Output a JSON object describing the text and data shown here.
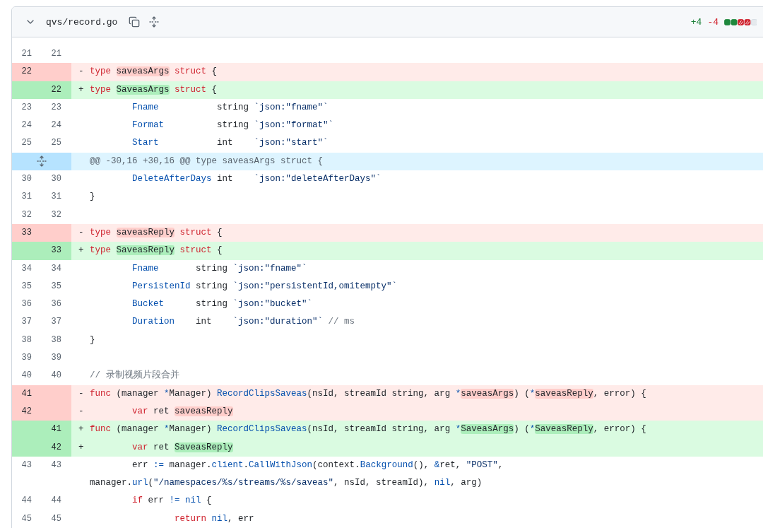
{
  "file": {
    "path": "qvs/record.go",
    "collapsed": false,
    "additions": "+4",
    "deletions": "-4"
  },
  "lines": [
    {
      "kind": "context",
      "old": "21",
      "new": "21"
    },
    {
      "kind": "deletion",
      "old": "22",
      "marker": "-",
      "tokens": [
        {
          "text": "type ",
          "kind": "keyword"
        },
        {
          "text": "saveasArgs",
          "kind": "changed"
        },
        {
          "text": " struct",
          "kind": "keyword"
        },
        {
          "text": " {",
          "kind": "plain"
        }
      ]
    },
    {
      "kind": "addition",
      "new": "22",
      "marker": "+",
      "tokens": [
        {
          "text": "type ",
          "kind": "keyword"
        },
        {
          "text": "SaveasArgs",
          "kind": "changed"
        },
        {
          "text": " struct",
          "kind": "keyword"
        },
        {
          "text": " {",
          "kind": "plain"
        }
      ]
    },
    {
      "kind": "context",
      "old": "23",
      "new": "23",
      "tokens": [
        {
          "text": "\tFname",
          "kind": "entity"
        },
        {
          "text": "           string ",
          "kind": "plain"
        },
        {
          "text": "`json:\"fname\"`",
          "kind": "string"
        }
      ]
    },
    {
      "kind": "context",
      "old": "24",
      "new": "24",
      "tokens": [
        {
          "text": "\tFormat",
          "kind": "entity"
        },
        {
          "text": "          string ",
          "kind": "plain"
        },
        {
          "text": "`json:\"format\"`",
          "kind": "string"
        }
      ]
    },
    {
      "kind": "context",
      "old": "25",
      "new": "25",
      "tokens": [
        {
          "text": "\tStart",
          "kind": "entity"
        },
        {
          "text": "           int    ",
          "kind": "plain"
        },
        {
          "text": "`json:\"start\"`",
          "kind": "string"
        }
      ]
    },
    {
      "kind": "hunk",
      "tokens": [
        {
          "text": "@@ -30,16 +30,16 @@ type saveasArgs struct {",
          "kind": "hunk"
        }
      ]
    },
    {
      "kind": "context",
      "old": "30",
      "new": "30",
      "tokens": [
        {
          "text": "\tDeleteAfterDays",
          "kind": "entity"
        },
        {
          "text": " int    ",
          "kind": "plain"
        },
        {
          "text": "`json:\"deleteAfterDays\"`",
          "kind": "string"
        }
      ]
    },
    {
      "kind": "context",
      "old": "31",
      "new": "31",
      "tokens": [
        {
          "text": "}",
          "kind": "plain"
        }
      ]
    },
    {
      "kind": "context",
      "old": "32",
      "new": "32"
    },
    {
      "kind": "deletion",
      "old": "33",
      "marker": "-",
      "tokens": [
        {
          "text": "type ",
          "kind": "keyword"
        },
        {
          "text": "saveasReply",
          "kind": "changed"
        },
        {
          "text": " struct",
          "kind": "keyword"
        },
        {
          "text": " {",
          "kind": "plain"
        }
      ]
    },
    {
      "kind": "addition",
      "new": "33",
      "marker": "+",
      "tokens": [
        {
          "text": "type ",
          "kind": "keyword"
        },
        {
          "text": "SaveasReply",
          "kind": "changed"
        },
        {
          "text": " struct",
          "kind": "keyword"
        },
        {
          "text": " {",
          "kind": "plain"
        }
      ]
    },
    {
      "kind": "context",
      "old": "34",
      "new": "34",
      "tokens": [
        {
          "text": "\tFname",
          "kind": "entity"
        },
        {
          "text": "       string ",
          "kind": "plain"
        },
        {
          "text": "`json:\"fname\"`",
          "kind": "string"
        }
      ]
    },
    {
      "kind": "context",
      "old": "35",
      "new": "35",
      "tokens": [
        {
          "text": "\tPersistenId",
          "kind": "entity"
        },
        {
          "text": " string ",
          "kind": "plain"
        },
        {
          "text": "`json:\"persistentId,omitempty\"`",
          "kind": "string"
        }
      ]
    },
    {
      "kind": "context",
      "old": "36",
      "new": "36",
      "tokens": [
        {
          "text": "\tBucket",
          "kind": "entity"
        },
        {
          "text": "      string ",
          "kind": "plain"
        },
        {
          "text": "`json:\"bucket\"`",
          "kind": "string"
        }
      ]
    },
    {
      "kind": "context",
      "old": "37",
      "new": "37",
      "tokens": [
        {
          "text": "\tDuration",
          "kind": "entity"
        },
        {
          "text": "    int    ",
          "kind": "plain"
        },
        {
          "text": "`json:\"duration\"`",
          "kind": "string"
        },
        {
          "text": " // ms",
          "kind": "comment"
        }
      ]
    },
    {
      "kind": "context",
      "old": "38",
      "new": "38",
      "tokens": [
        {
          "text": "}",
          "kind": "plain"
        }
      ]
    },
    {
      "kind": "context",
      "old": "39",
      "new": "39"
    },
    {
      "kind": "context",
      "old": "40",
      "new": "40",
      "tokens": [
        {
          "text": "// 录制视频片段合并",
          "kind": "comment"
        }
      ]
    },
    {
      "kind": "deletion",
      "old": "41",
      "marker": "-",
      "tokens": [
        {
          "text": "func",
          "kind": "keyword"
        },
        {
          "text": " (manager ",
          "kind": "plain"
        },
        {
          "text": "*",
          "kind": "entity"
        },
        {
          "text": "Manager) ",
          "kind": "plain"
        },
        {
          "text": "RecordClipsSaveas",
          "kind": "entity"
        },
        {
          "text": "(nsId, streamId string, arg ",
          "kind": "plain"
        },
        {
          "text": "*",
          "kind": "entity"
        },
        {
          "text": "saveasArgs",
          "kind": "changed"
        },
        {
          "text": ") (",
          "kind": "plain"
        },
        {
          "text": "*",
          "kind": "entity"
        },
        {
          "text": "saveasReply",
          "kind": "changed"
        },
        {
          "text": ", error) {",
          "kind": "plain"
        }
      ]
    },
    {
      "kind": "deletion",
      "old": "42",
      "marker": "-",
      "tokens": [
        {
          "text": "\tvar",
          "kind": "keyword"
        },
        {
          "text": " ret ",
          "kind": "plain"
        },
        {
          "text": "saveasReply",
          "kind": "changed"
        }
      ]
    },
    {
      "kind": "addition",
      "new": "41",
      "marker": "+",
      "tokens": [
        {
          "text": "func",
          "kind": "keyword"
        },
        {
          "text": " (manager ",
          "kind": "plain"
        },
        {
          "text": "*",
          "kind": "entity"
        },
        {
          "text": "Manager) ",
          "kind": "plain"
        },
        {
          "text": "RecordClipsSaveas",
          "kind": "entity"
        },
        {
          "text": "(nsId, streamId string, arg ",
          "kind": "plain"
        },
        {
          "text": "*",
          "kind": "entity"
        },
        {
          "text": "SaveasArgs",
          "kind": "changed"
        },
        {
          "text": ") (",
          "kind": "plain"
        },
        {
          "text": "*",
          "kind": "entity"
        },
        {
          "text": "SaveasReply",
          "kind": "changed"
        },
        {
          "text": ", error) {",
          "kind": "plain"
        }
      ]
    },
    {
      "kind": "addition",
      "new": "42",
      "marker": "+",
      "tokens": [
        {
          "text": "\tvar",
          "kind": "keyword"
        },
        {
          "text": " ret ",
          "kind": "plain"
        },
        {
          "text": "SaveasReply",
          "kind": "changed"
        }
      ]
    },
    {
      "kind": "context",
      "old": "43",
      "new": "43",
      "tokens": [
        {
          "text": "\terr ",
          "kind": "plain"
        },
        {
          "text": ":=",
          "kind": "entity"
        },
        {
          "text": " manager.",
          "kind": "plain"
        },
        {
          "text": "client",
          "kind": "entity"
        },
        {
          "text": ".",
          "kind": "plain"
        },
        {
          "text": "CallWithJson",
          "kind": "entity"
        },
        {
          "text": "(context.",
          "kind": "plain"
        },
        {
          "text": "Background",
          "kind": "entity"
        },
        {
          "text": "(), ",
          "kind": "plain"
        },
        {
          "text": "&",
          "kind": "entity"
        },
        {
          "text": "ret, ",
          "kind": "plain"
        },
        {
          "text": "\"POST\"",
          "kind": "string"
        },
        {
          "text": ", manager.",
          "kind": "plain"
        },
        {
          "text": "url",
          "kind": "entity"
        },
        {
          "text": "(",
          "kind": "plain"
        },
        {
          "text": "\"/namespaces/%s/streams/%s/saveas\"",
          "kind": "string"
        },
        {
          "text": ", nsId, streamId), ",
          "kind": "plain"
        },
        {
          "text": "nil",
          "kind": "entity"
        },
        {
          "text": ", arg)",
          "kind": "plain"
        }
      ]
    },
    {
      "kind": "context",
      "old": "44",
      "new": "44",
      "tokens": [
        {
          "text": "\tif",
          "kind": "keyword"
        },
        {
          "text": " err ",
          "kind": "plain"
        },
        {
          "text": "!=",
          "kind": "entity"
        },
        {
          "text": " nil",
          "kind": "entity"
        },
        {
          "text": " {",
          "kind": "plain"
        }
      ]
    },
    {
      "kind": "context",
      "old": "45",
      "new": "45",
      "tokens": [
        {
          "text": "\t\treturn",
          "kind": "keyword"
        },
        {
          "text": " nil",
          "kind": "entity"
        },
        {
          "text": ", err",
          "kind": "plain"
        }
      ]
    }
  ]
}
